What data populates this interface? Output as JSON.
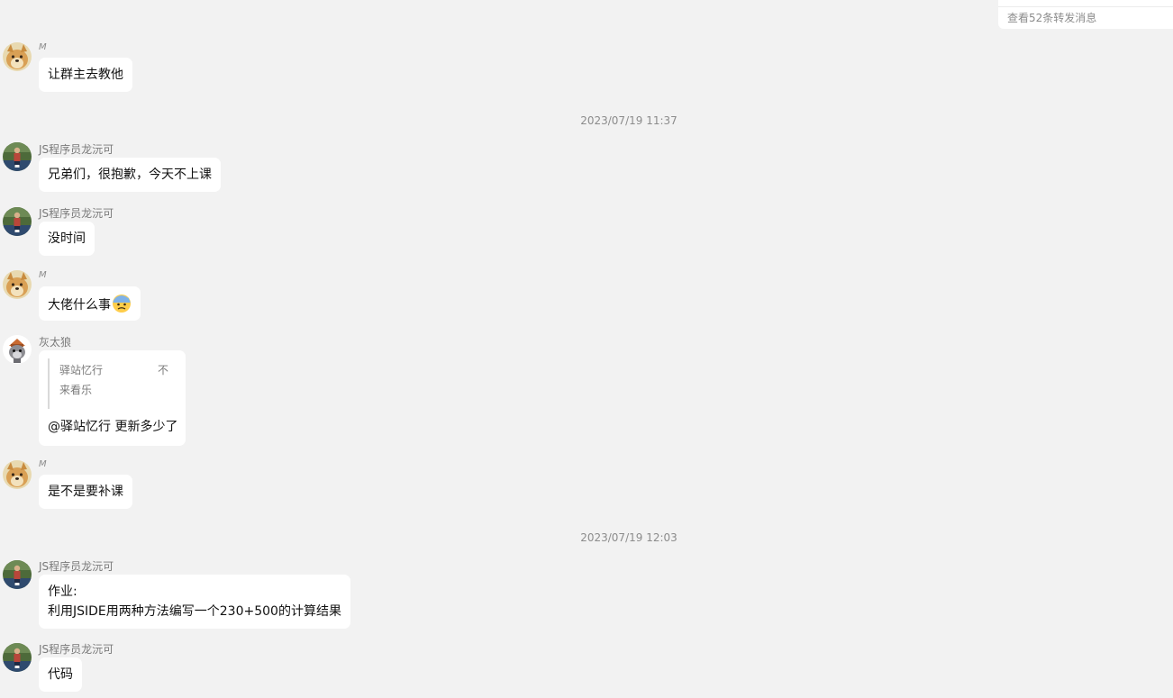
{
  "forward": {
    "link_text": "查看52条转发消息"
  },
  "timestamps": [
    "2023/07/19 11:37",
    "2023/07/19 12:03"
  ],
  "senders": {
    "m": "M",
    "js": "JS程序员龙沅可",
    "wolf": "灰太狼"
  },
  "messages": [
    {
      "sender": "M",
      "text": "让群主去教他"
    },
    {
      "sender": "JS程序员龙沅可",
      "text": "兄弟们，很抱歉，今天不上课"
    },
    {
      "sender": "JS程序员龙沅可",
      "text": "没时间"
    },
    {
      "sender": "M",
      "text": "大佬什么事",
      "emoji": "anxious-sweat-face"
    },
    {
      "sender": "灰太狼",
      "quote": {
        "author": "驿站忆行",
        "text_part1": "不",
        "text_part2": "来看乐"
      },
      "text": "@驿站忆行 更新多少了"
    },
    {
      "sender": "M",
      "text": "是不是要补课"
    },
    {
      "sender": "JS程序员龙沅可",
      "line1": "作业:",
      "line2": "利用JSIDE用两种方法编写一个230+500的计算结果"
    },
    {
      "sender": "JS程序员龙沅可",
      "text": "代码"
    }
  ],
  "icons": {
    "doge_avatar": "doge-avatar-icon",
    "js_avatar": "programmer-avatar-icon",
    "wolf_avatar": "grey-wolf-avatar-icon"
  }
}
